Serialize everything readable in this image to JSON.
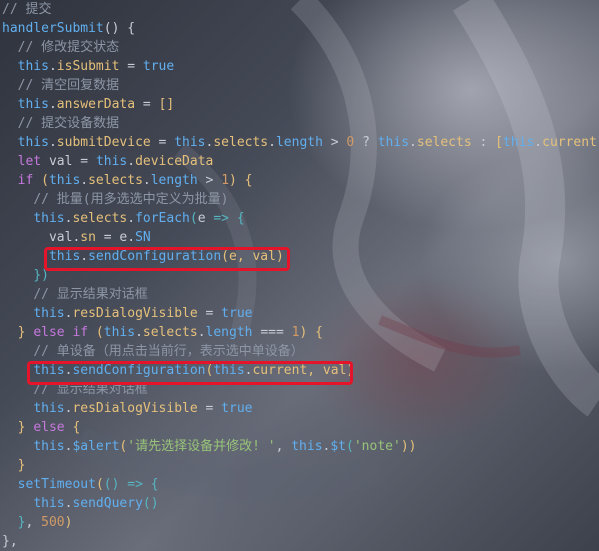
{
  "editor": {
    "lines": [
      {
        "indent": "",
        "tokens": [
          {
            "t": "// 提交",
            "c": "c"
          }
        ]
      },
      {
        "indent": "",
        "tokens": [
          {
            "t": "handlerSubmit",
            "c": "f"
          },
          {
            "t": "() {",
            "c": "pl"
          }
        ]
      },
      {
        "indent": "  ",
        "tokens": [
          {
            "t": "// 修改提交状态",
            "c": "c"
          }
        ]
      },
      {
        "indent": "  ",
        "tokens": [
          {
            "t": "this",
            "c": "t"
          },
          {
            "t": ".",
            "c": "pl"
          },
          {
            "t": "isSubmit",
            "c": "p"
          },
          {
            "t": " = ",
            "c": "pl"
          },
          {
            "t": "true",
            "c": "t"
          }
        ]
      },
      {
        "indent": "  ",
        "tokens": [
          {
            "t": "// 清空回复数据",
            "c": "c"
          }
        ]
      },
      {
        "indent": "  ",
        "tokens": [
          {
            "t": "this",
            "c": "t"
          },
          {
            "t": ".",
            "c": "pl"
          },
          {
            "t": "answerData",
            "c": "p"
          },
          {
            "t": " = ",
            "c": "pl"
          },
          {
            "t": "[]",
            "c": "b"
          }
        ]
      },
      {
        "indent": "  ",
        "tokens": [
          {
            "t": "// 提交设备数据",
            "c": "c"
          }
        ]
      },
      {
        "indent": "  ",
        "tokens": [
          {
            "t": "this",
            "c": "t"
          },
          {
            "t": ".",
            "c": "pl"
          },
          {
            "t": "submitDevice",
            "c": "p"
          },
          {
            "t": " = ",
            "c": "pl"
          },
          {
            "t": "this",
            "c": "t"
          },
          {
            "t": ".",
            "c": "pl"
          },
          {
            "t": "selects",
            "c": "p"
          },
          {
            "t": ".",
            "c": "pl"
          },
          {
            "t": "length",
            "c": "t"
          },
          {
            "t": " > ",
            "c": "pl"
          },
          {
            "t": "0",
            "c": "n"
          },
          {
            "t": " ? ",
            "c": "pl"
          },
          {
            "t": "this",
            "c": "t"
          },
          {
            "t": ".",
            "c": "pl"
          },
          {
            "t": "selects",
            "c": "p"
          },
          {
            "t": " : ",
            "c": "pl"
          },
          {
            "t": "[",
            "c": "b"
          },
          {
            "t": "this",
            "c": "t"
          },
          {
            "t": ".",
            "c": "pl"
          },
          {
            "t": "current",
            "c": "p"
          },
          {
            "t": "]",
            "c": "b"
          }
        ]
      },
      {
        "indent": "  ",
        "tokens": [
          {
            "t": "let",
            "c": "k"
          },
          {
            "t": " val = ",
            "c": "pl"
          },
          {
            "t": "this",
            "c": "t"
          },
          {
            "t": ".",
            "c": "pl"
          },
          {
            "t": "deviceData",
            "c": "p"
          }
        ]
      },
      {
        "indent": "  ",
        "tokens": [
          {
            "t": "if",
            "c": "k"
          },
          {
            "t": " (",
            "c": "b"
          },
          {
            "t": "this",
            "c": "t"
          },
          {
            "t": ".",
            "c": "pl"
          },
          {
            "t": "selects",
            "c": "p"
          },
          {
            "t": ".",
            "c": "pl"
          },
          {
            "t": "length",
            "c": "t"
          },
          {
            "t": " > ",
            "c": "pl"
          },
          {
            "t": "1",
            "c": "n"
          },
          {
            "t": ") {",
            "c": "b"
          }
        ]
      },
      {
        "indent": "    ",
        "tokens": [
          {
            "t": "// 批量(用多选选中定义为批量)",
            "c": "c"
          }
        ]
      },
      {
        "indent": "    ",
        "tokens": [
          {
            "t": "this",
            "c": "t"
          },
          {
            "t": ".",
            "c": "pl"
          },
          {
            "t": "selects",
            "c": "p"
          },
          {
            "t": ".",
            "c": "pl"
          },
          {
            "t": "forEach",
            "c": "f"
          },
          {
            "t": "(",
            "c": "o"
          },
          {
            "t": "e",
            "c": "pl"
          },
          {
            "t": " => {",
            "c": "o"
          }
        ]
      },
      {
        "indent": "      ",
        "tokens": [
          {
            "t": "val",
            "c": "pl"
          },
          {
            "t": ".",
            "c": "pl"
          },
          {
            "t": "sn",
            "c": "p"
          },
          {
            "t": " = e.",
            "c": "pl"
          },
          {
            "t": "SN",
            "c": "t"
          }
        ]
      },
      {
        "indent": "      ",
        "tokens": [
          {
            "t": "this",
            "c": "t"
          },
          {
            "t": ".",
            "c": "pl"
          },
          {
            "t": "sendConfiguration",
            "c": "f"
          },
          {
            "t": "(e, val)",
            "c": "b"
          }
        ]
      },
      {
        "indent": "    ",
        "tokens": [
          {
            "t": "})",
            "c": "o"
          }
        ]
      },
      {
        "indent": "    ",
        "tokens": [
          {
            "t": "// 显示结果对话框",
            "c": "c"
          }
        ]
      },
      {
        "indent": "    ",
        "tokens": [
          {
            "t": "this",
            "c": "t"
          },
          {
            "t": ".",
            "c": "pl"
          },
          {
            "t": "resDialogVisible",
            "c": "p"
          },
          {
            "t": " = ",
            "c": "pl"
          },
          {
            "t": "true",
            "c": "t"
          }
        ]
      },
      {
        "indent": "  ",
        "tokens": [
          {
            "t": "}",
            "c": "b"
          },
          {
            "t": " ",
            "c": "pl"
          },
          {
            "t": "else",
            "c": "k"
          },
          {
            "t": " ",
            "c": "pl"
          },
          {
            "t": "if",
            "c": "k"
          },
          {
            "t": " (",
            "c": "b"
          },
          {
            "t": "this",
            "c": "t"
          },
          {
            "t": ".",
            "c": "pl"
          },
          {
            "t": "selects",
            "c": "p"
          },
          {
            "t": ".",
            "c": "pl"
          },
          {
            "t": "length",
            "c": "t"
          },
          {
            "t": " === ",
            "c": "pl"
          },
          {
            "t": "1",
            "c": "n"
          },
          {
            "t": ") {",
            "c": "b"
          }
        ]
      },
      {
        "indent": "    ",
        "tokens": [
          {
            "t": "// 单设备（用点击当前行，表示选中单设备）",
            "c": "c"
          }
        ]
      },
      {
        "indent": "    ",
        "tokens": [
          {
            "t": "this",
            "c": "t"
          },
          {
            "t": ".",
            "c": "pl"
          },
          {
            "t": "sendConfiguration",
            "c": "f"
          },
          {
            "t": "(",
            "c": "b"
          },
          {
            "t": "this",
            "c": "t"
          },
          {
            "t": ".",
            "c": "pl"
          },
          {
            "t": "current",
            "c": "p"
          },
          {
            "t": ", val)",
            "c": "b"
          }
        ]
      },
      {
        "indent": "    ",
        "tokens": [
          {
            "t": "// 显示结果对话框",
            "c": "c"
          }
        ]
      },
      {
        "indent": "    ",
        "tokens": [
          {
            "t": "this",
            "c": "t"
          },
          {
            "t": ".",
            "c": "pl"
          },
          {
            "t": "resDialogVisible",
            "c": "p"
          },
          {
            "t": " = ",
            "c": "pl"
          },
          {
            "t": "true",
            "c": "t"
          }
        ]
      },
      {
        "indent": "  ",
        "tokens": [
          {
            "t": "}",
            "c": "b"
          },
          {
            "t": " ",
            "c": "pl"
          },
          {
            "t": "else",
            "c": "k"
          },
          {
            "t": " {",
            "c": "b"
          }
        ]
      },
      {
        "indent": "    ",
        "tokens": [
          {
            "t": "this",
            "c": "t"
          },
          {
            "t": ".",
            "c": "pl"
          },
          {
            "t": "$alert",
            "c": "f"
          },
          {
            "t": "(",
            "c": "b"
          },
          {
            "t": "'请先选择设备并修改! '",
            "c": "s"
          },
          {
            "t": ", ",
            "c": "pl"
          },
          {
            "t": "this",
            "c": "t"
          },
          {
            "t": ".",
            "c": "pl"
          },
          {
            "t": "$t",
            "c": "f"
          },
          {
            "t": "(",
            "c": "o"
          },
          {
            "t": "'note'",
            "c": "s"
          },
          {
            "t": "))",
            "c": "b"
          }
        ]
      },
      {
        "indent": "  ",
        "tokens": [
          {
            "t": "}",
            "c": "b"
          }
        ]
      },
      {
        "indent": "  ",
        "tokens": [
          {
            "t": "setTimeout",
            "c": "f"
          },
          {
            "t": "(",
            "c": "b"
          },
          {
            "t": "()",
            "c": "o"
          },
          {
            "t": " => {",
            "c": "o"
          }
        ]
      },
      {
        "indent": "    ",
        "tokens": [
          {
            "t": "this",
            "c": "t"
          },
          {
            "t": ".",
            "c": "pl"
          },
          {
            "t": "sendQuery",
            "c": "f"
          },
          {
            "t": "()",
            "c": "o"
          }
        ]
      },
      {
        "indent": "  ",
        "tokens": [
          {
            "t": "}",
            "c": "o"
          },
          {
            "t": ", ",
            "c": "pl"
          },
          {
            "t": "500",
            "c": "n"
          },
          {
            "t": ")",
            "c": "b"
          }
        ]
      },
      {
        "indent": "",
        "tokens": [
          {
            "t": "},",
            "c": "pl"
          }
        ]
      }
    ]
  },
  "colors": {
    "highlight_border": "#e4152a",
    "comment": "#8d96a6",
    "keyword": "#c678dd",
    "this": "#61afef",
    "property": "#e5c07b",
    "number": "#d19a66",
    "string": "#98c379"
  }
}
